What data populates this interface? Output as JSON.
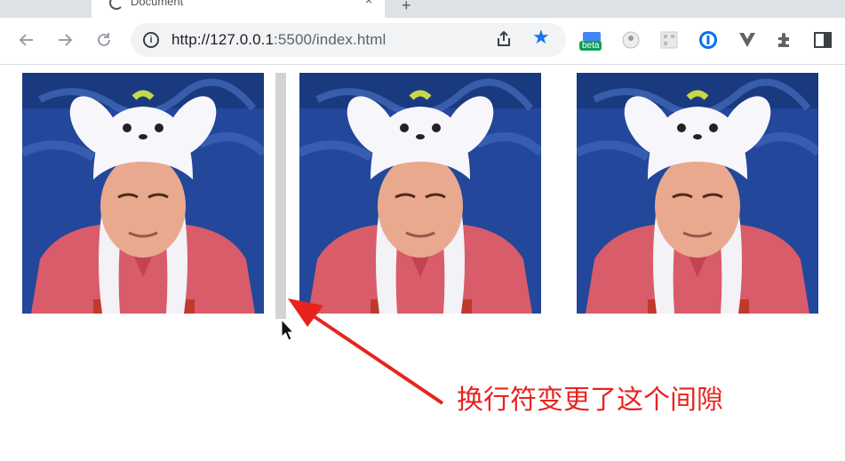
{
  "browser": {
    "tab_title": "Document",
    "tab_close": "×",
    "new_tab": "+",
    "url_host": "http://127.0.0.1",
    "url_rest": ":5500/index.html",
    "beta_label": "beta",
    "icons": [
      "back-icon",
      "forward-icon",
      "reload-icon",
      "info-icon",
      "share-icon",
      "star-icon",
      "extension-beta-icon",
      "extension-circle-icon",
      "extension-qr-icon",
      "extension-password-icon",
      "extension-vue-icon",
      "puzzle-icon",
      "sidepanel-icon"
    ]
  },
  "page": {
    "images": [
      {
        "name": "image-1"
      },
      {
        "name": "image-2"
      },
      {
        "name": "image-3"
      }
    ],
    "annotation_text": "换行符变更了这个间隙",
    "annotation_color": "#e8231f"
  }
}
